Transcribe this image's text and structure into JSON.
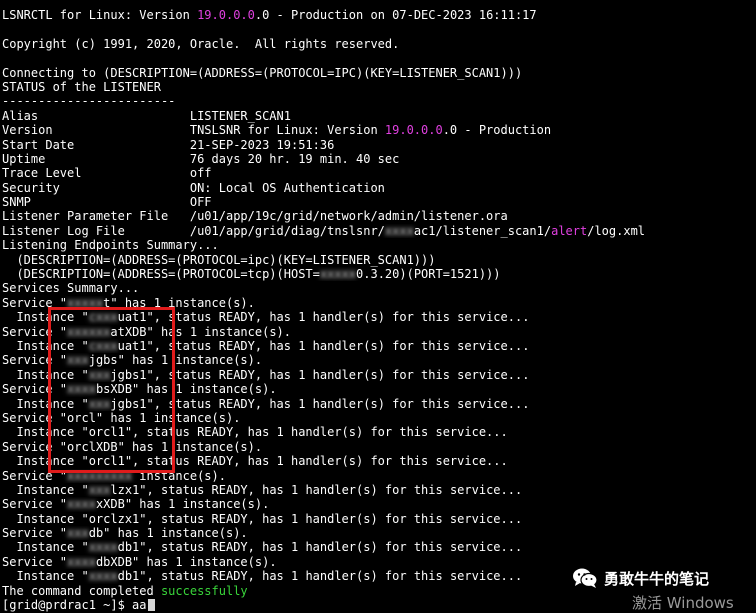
{
  "terminal": {
    "colors": {
      "background": "#000000",
      "text": "#ffffff",
      "version": "#e040e0",
      "alert": "#e040e0",
      "success": "#39d43a",
      "highlight_box": "#e01b1b"
    },
    "lines": [
      [
        {
          "t": "LSNRCTL for Linux: Version "
        },
        {
          "t": "19.0.0.0",
          "c": "magenta"
        },
        {
          "t": ".0 - Production on 07-DEC-2023 16:11:17"
        }
      ],
      [
        {
          "t": ""
        }
      ],
      [
        {
          "t": "Copyright (c) 1991, 2020, Oracle.  All rights reserved."
        }
      ],
      [
        {
          "t": ""
        }
      ],
      [
        {
          "t": "Connecting to (DESCRIPTION=(ADDRESS=(PROTOCOL=IPC)(KEY=LISTENER_SCAN1)))"
        }
      ],
      [
        {
          "t": "STATUS of the LISTENER"
        }
      ],
      [
        {
          "t": "------------------------"
        }
      ],
      [
        {
          "t": "Alias                     LISTENER_SCAN1"
        }
      ],
      [
        {
          "t": "Version                   TNSLSNR for Linux: Version "
        },
        {
          "t": "19.0.0.0",
          "c": "magenta"
        },
        {
          "t": ".0 - Production"
        }
      ],
      [
        {
          "t": "Start Date                21-SEP-2023 19:51:36"
        }
      ],
      [
        {
          "t": "Uptime                    76 days 20 hr. 19 min. 40 sec"
        }
      ],
      [
        {
          "t": "Trace Level               off"
        }
      ],
      [
        {
          "t": "Security                  ON: Local OS Authentication"
        }
      ],
      [
        {
          "t": "SNMP                      OFF"
        }
      ],
      [
        {
          "t": "Listener Parameter File   /u01/app/19c/grid/network/admin/listener.ora"
        }
      ],
      [
        {
          "t": "Listener Log File         /u01/app/grid/diag/tnslsnr/"
        },
        {
          "t": "xxxx",
          "c": "blur"
        },
        {
          "t": "ac1/listener_scan1/"
        },
        {
          "t": "alert",
          "c": "magenta"
        },
        {
          "t": "/log.xml"
        }
      ],
      [
        {
          "t": "Listening Endpoints Summary..."
        }
      ],
      [
        {
          "t": "  (DESCRIPTION=(ADDRESS=(PROTOCOL=ipc)(KEY=LISTENER_SCAN1)))"
        }
      ],
      [
        {
          "t": "  (DESCRIPTION=(ADDRESS=(PROTOCOL=tcp)(HOST="
        },
        {
          "t": "xxxxx",
          "c": "blur"
        },
        {
          "t": "0.3.20)(PORT=1521)))"
        }
      ],
      [
        {
          "t": "Services Summary..."
        }
      ],
      [
        {
          "t": "Service \""
        },
        {
          "t": "xxxxx",
          "c": "blur"
        },
        {
          "t": "t\" has 1 instance(s)."
        }
      ],
      [
        {
          "t": "  Instance \""
        },
        {
          "t": "cxxx",
          "c": "blur"
        },
        {
          "t": "uat1\", status READY, has 1 handler(s) for this service..."
        }
      ],
      [
        {
          "t": "Service \""
        },
        {
          "t": "xxxxxx",
          "c": "blur"
        },
        {
          "t": "atXDB\" has 1 instance(s)."
        }
      ],
      [
        {
          "t": "  Instance \""
        },
        {
          "t": "cxxx",
          "c": "blur"
        },
        {
          "t": "uat1\", status READY, has 1 handler(s) for this service..."
        }
      ],
      [
        {
          "t": "Service \""
        },
        {
          "t": "xxx",
          "c": "blur"
        },
        {
          "t": "jgbs\" has 1 instance(s)."
        }
      ],
      [
        {
          "t": "  Instance \""
        },
        {
          "t": "xxx",
          "c": "blur"
        },
        {
          "t": "jgbs1\", status READY, has 1 handler(s) for this service..."
        }
      ],
      [
        {
          "t": "Service \""
        },
        {
          "t": "xxxx",
          "c": "blur"
        },
        {
          "t": "bsXDB\" has 1 instance(s)."
        }
      ],
      [
        {
          "t": "  Instance \""
        },
        {
          "t": "xxx",
          "c": "blur"
        },
        {
          "t": "jgbs1\", status READY, has 1 handler(s) for this service..."
        }
      ],
      [
        {
          "t": "Service \"orcl\" has 1 instance(s)."
        }
      ],
      [
        {
          "t": "  Instance \"orcl1\", status READY, has 1 handler(s) for this service..."
        }
      ],
      [
        {
          "t": "Service \"orclXDB\" has 1 instance(s)."
        }
      ],
      [
        {
          "t": "  Instance \"orcl1\", status READY, has 1 handler(s) for this service..."
        }
      ],
      [
        {
          "t": "Service \""
        },
        {
          "t": "xxxxxxxxx",
          "c": "blur"
        },
        {
          "t": " instance(s)."
        }
      ],
      [
        {
          "t": "  Instance \""
        },
        {
          "t": "xxx",
          "c": "blur"
        },
        {
          "t": "lzx1\", status READY, has 1 handler(s) for this service..."
        }
      ],
      [
        {
          "t": "Service \""
        },
        {
          "t": "xxxx",
          "c": "blur"
        },
        {
          "t": "xXDB\" has 1 instance(s)."
        }
      ],
      [
        {
          "t": "  Instance \"orclzx1\", status READY, has 1 handler(s) for this service..."
        }
      ],
      [
        {
          "t": "Service \""
        },
        {
          "t": "xxx",
          "c": "blur"
        },
        {
          "t": "db\" has 1 instance(s)."
        }
      ],
      [
        {
          "t": "  Instance \""
        },
        {
          "t": "xxxx",
          "c": "blur"
        },
        {
          "t": "db1\", status READY, has 1 handler(s) for this service..."
        }
      ],
      [
        {
          "t": "Service \""
        },
        {
          "t": "xxxx",
          "c": "blur"
        },
        {
          "t": "dbXDB\" has 1 instance(s)."
        }
      ],
      [
        {
          "t": "  Instance \""
        },
        {
          "t": "xxxx",
          "c": "blur"
        },
        {
          "t": "db1\", status READY, has 1 handler(s) for this service..."
        }
      ],
      [
        {
          "t": "The command completed "
        },
        {
          "t": "successfully",
          "c": "green"
        }
      ],
      [
        {
          "t": "[grid@prdrac1 ~]$ aa"
        }
      ]
    ]
  },
  "watermark": {
    "icon": "wechat-icon",
    "text": "勇敢牛牛的笔记"
  },
  "activation": {
    "text": "激活 Windows"
  }
}
